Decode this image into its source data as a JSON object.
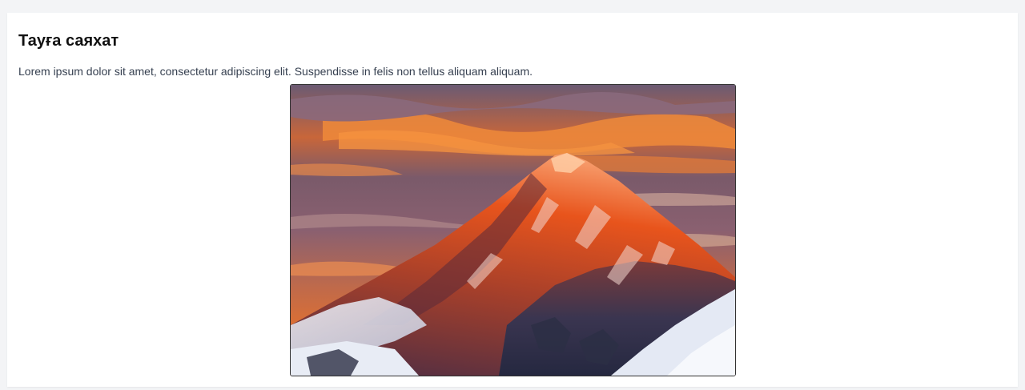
{
  "card": {
    "title": "Тауға саяхат",
    "description": "Lorem ipsum dolor sit amet, consectetur adipiscing elit. Suspendisse in felis non tellus aliquam aliquam."
  },
  "image": {
    "subject": "snow-capped mountain peak at sunset",
    "colors": {
      "sky_top": "#6b5a73",
      "sky_orange": "#f07a2a",
      "peak_orange": "#e8541c",
      "snow": "#e8ecf5",
      "rock_dark": "#2c2f45"
    }
  },
  "theme": {
    "page_background": "#f3f4f6",
    "card_background": "#ffffff",
    "title_color": "#111111",
    "text_color": "#374151"
  }
}
